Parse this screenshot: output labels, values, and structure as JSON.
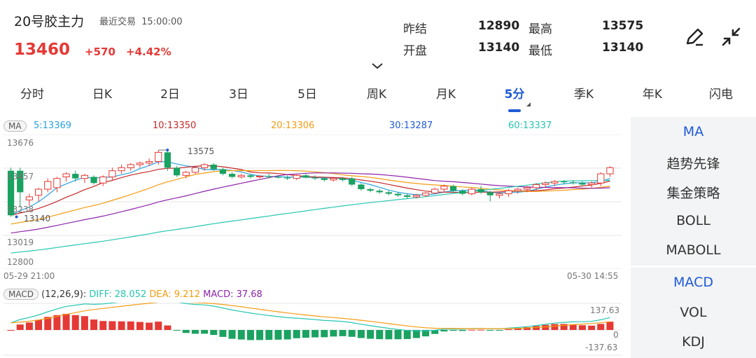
{
  "header": {
    "title": "20号胶主力",
    "recent_label": "最近交易",
    "recent_time": "15:00:00",
    "price": "13460",
    "change": "+570",
    "change_pct": "+4.42%"
  },
  "stats": {
    "prev_settle_label": "昨结",
    "prev_settle": "12890",
    "high_label": "最高",
    "high": "13575",
    "open_label": "开盘",
    "open": "13140",
    "low_label": "最低",
    "low": "13140"
  },
  "tabs": [
    {
      "label": "分时"
    },
    {
      "label": "日K"
    },
    {
      "label": "2日"
    },
    {
      "label": "3日"
    },
    {
      "label": "5日"
    },
    {
      "label": "周K"
    },
    {
      "label": "月K"
    },
    {
      "label": "5分"
    },
    {
      "label": "季K"
    },
    {
      "label": "年K"
    },
    {
      "label": "闪电"
    }
  ],
  "active_tab": "5分",
  "ma_bar": {
    "badge": "MA",
    "ma5": "5:13369",
    "ma10": "10:13350",
    "ma20": "20:13306",
    "ma30": "30:13287",
    "ma60": "60:13337"
  },
  "price_axis": {
    "top": "13676",
    "l2": "13457",
    "l3": "13238",
    "l4": "13019",
    "bottom": "12800"
  },
  "annotations": {
    "high": "13575",
    "low": "13140"
  },
  "time_axis": {
    "start": "05-29 21:00",
    "end": "05-30 14:55"
  },
  "macd_bar": {
    "badge": "MACD",
    "params": "(12,26,9):",
    "diff": "DIFF: 28.052",
    "dea": "DEA: 9.212",
    "macd": "MACD: 37.68"
  },
  "macd_axis": {
    "top": "137.63",
    "mid": "0",
    "bottom": "-137.63"
  },
  "side_menu": {
    "main": [
      "MA",
      "趋势先锋",
      "集金策略",
      "BOLL",
      "MABOLL"
    ],
    "sub": [
      "MACD",
      "VOL",
      "KDJ"
    ]
  },
  "colors": {
    "up": "#e53935",
    "down": "#1aa260",
    "accent": "#1e5bd6",
    "ma5": "#29a3e0",
    "ma10": "#c62828",
    "ma20": "#f39c12",
    "ma30": "#8e24aa",
    "ma60": "#26c6b0"
  },
  "chart_data": {
    "type": "candlestick",
    "ylim": [
      12800,
      13676
    ],
    "x_range": [
      "05-29 21:00",
      "05-30 14:55"
    ],
    "candles": [
      {
        "o": 13440,
        "h": 13460,
        "l": 13140,
        "c": 13150
      },
      {
        "o": 13440,
        "h": 13460,
        "l": 13200,
        "c": 13300
      },
      {
        "o": 13250,
        "h": 13290,
        "l": 13210,
        "c": 13270
      },
      {
        "o": 13280,
        "h": 13330,
        "l": 13240,
        "c": 13320
      },
      {
        "o": 13320,
        "h": 13390,
        "l": 13300,
        "c": 13370
      },
      {
        "o": 13330,
        "h": 13400,
        "l": 13300,
        "c": 13390
      },
      {
        "o": 13400,
        "h": 13430,
        "l": 13370,
        "c": 13420
      },
      {
        "o": 13420,
        "h": 13440,
        "l": 13370,
        "c": 13390
      },
      {
        "o": 13390,
        "h": 13420,
        "l": 13360,
        "c": 13410
      },
      {
        "o": 13400,
        "h": 13410,
        "l": 13350,
        "c": 13360
      },
      {
        "o": 13360,
        "h": 13410,
        "l": 13340,
        "c": 13400
      },
      {
        "o": 13400,
        "h": 13460,
        "l": 13380,
        "c": 13440
      },
      {
        "o": 13440,
        "h": 13480,
        "l": 13420,
        "c": 13460
      },
      {
        "o": 13460,
        "h": 13490,
        "l": 13440,
        "c": 13480
      },
      {
        "o": 13480,
        "h": 13500,
        "l": 13460,
        "c": 13490
      },
      {
        "o": 13490,
        "h": 13520,
        "l": 13470,
        "c": 13500
      },
      {
        "o": 13500,
        "h": 13575,
        "l": 13480,
        "c": 13560
      },
      {
        "o": 13560,
        "h": 13575,
        "l": 13440,
        "c": 13460
      },
      {
        "o": 13460,
        "h": 13470,
        "l": 13400,
        "c": 13410
      },
      {
        "o": 13410,
        "h": 13440,
        "l": 13390,
        "c": 13430
      },
      {
        "o": 13430,
        "h": 13470,
        "l": 13420,
        "c": 13460
      },
      {
        "o": 13460,
        "h": 13490,
        "l": 13440,
        "c": 13480
      },
      {
        "o": 13480,
        "h": 13490,
        "l": 13440,
        "c": 13450
      },
      {
        "o": 13450,
        "h": 13460,
        "l": 13410,
        "c": 13420
      },
      {
        "o": 13420,
        "h": 13430,
        "l": 13390,
        "c": 13400
      },
      {
        "o": 13400,
        "h": 13420,
        "l": 13390,
        "c": 13410
      },
      {
        "o": 13410,
        "h": 13420,
        "l": 13390,
        "c": 13400
      },
      {
        "o": 13400,
        "h": 13410,
        "l": 13390,
        "c": 13405
      },
      {
        "o": 13405,
        "h": 13420,
        "l": 13390,
        "c": 13400
      },
      {
        "o": 13400,
        "h": 13410,
        "l": 13390,
        "c": 13395
      },
      {
        "o": 13395,
        "h": 13410,
        "l": 13380,
        "c": 13390
      },
      {
        "o": 13390,
        "h": 13420,
        "l": 13380,
        "c": 13410
      },
      {
        "o": 13410,
        "h": 13420,
        "l": 13390,
        "c": 13395
      },
      {
        "o": 13395,
        "h": 13410,
        "l": 13380,
        "c": 13390
      },
      {
        "o": 13390,
        "h": 13400,
        "l": 13370,
        "c": 13380
      },
      {
        "o": 13380,
        "h": 13400,
        "l": 13370,
        "c": 13390
      },
      {
        "o": 13390,
        "h": 13400,
        "l": 13370,
        "c": 13380
      },
      {
        "o": 13390,
        "h": 13400,
        "l": 13340,
        "c": 13350
      },
      {
        "o": 13350,
        "h": 13360,
        "l": 13310,
        "c": 13320
      },
      {
        "o": 13320,
        "h": 13330,
        "l": 13300,
        "c": 13310
      },
      {
        "o": 13310,
        "h": 13320,
        "l": 13290,
        "c": 13300
      },
      {
        "o": 13300,
        "h": 13310,
        "l": 13280,
        "c": 13290
      },
      {
        "o": 13290,
        "h": 13300,
        "l": 13270,
        "c": 13280
      },
      {
        "o": 13280,
        "h": 13290,
        "l": 13260,
        "c": 13270
      },
      {
        "o": 13270,
        "h": 13290,
        "l": 13260,
        "c": 13280
      },
      {
        "o": 13280,
        "h": 13300,
        "l": 13270,
        "c": 13295
      },
      {
        "o": 13295,
        "h": 13330,
        "l": 13290,
        "c": 13320
      },
      {
        "o": 13320,
        "h": 13350,
        "l": 13300,
        "c": 13340
      },
      {
        "o": 13340,
        "h": 13350,
        "l": 13300,
        "c": 13310
      },
      {
        "o": 13310,
        "h": 13320,
        "l": 13280,
        "c": 13290
      },
      {
        "o": 13290,
        "h": 13330,
        "l": 13280,
        "c": 13320
      },
      {
        "o": 13320,
        "h": 13340,
        "l": 13290,
        "c": 13300
      },
      {
        "o": 13300,
        "h": 13310,
        "l": 13240,
        "c": 13280
      },
      {
        "o": 13280,
        "h": 13300,
        "l": 13260,
        "c": 13290
      },
      {
        "o": 13290,
        "h": 13320,
        "l": 13270,
        "c": 13310
      },
      {
        "o": 13310,
        "h": 13330,
        "l": 13290,
        "c": 13320
      },
      {
        "o": 13320,
        "h": 13340,
        "l": 13300,
        "c": 13330
      },
      {
        "o": 13330,
        "h": 13360,
        "l": 13310,
        "c": 13350
      },
      {
        "o": 13350,
        "h": 13370,
        "l": 13330,
        "c": 13360
      },
      {
        "o": 13360,
        "h": 13380,
        "l": 13340,
        "c": 13370
      },
      {
        "o": 13370,
        "h": 13380,
        "l": 13350,
        "c": 13365
      },
      {
        "o": 13365,
        "h": 13380,
        "l": 13350,
        "c": 13360
      },
      {
        "o": 13360,
        "h": 13370,
        "l": 13340,
        "c": 13350
      },
      {
        "o": 13350,
        "h": 13370,
        "l": 13330,
        "c": 13360
      },
      {
        "o": 13360,
        "h": 13430,
        "l": 13340,
        "c": 13420
      },
      {
        "o": 13420,
        "h": 13470,
        "l": 13400,
        "c": 13460
      }
    ]
  }
}
